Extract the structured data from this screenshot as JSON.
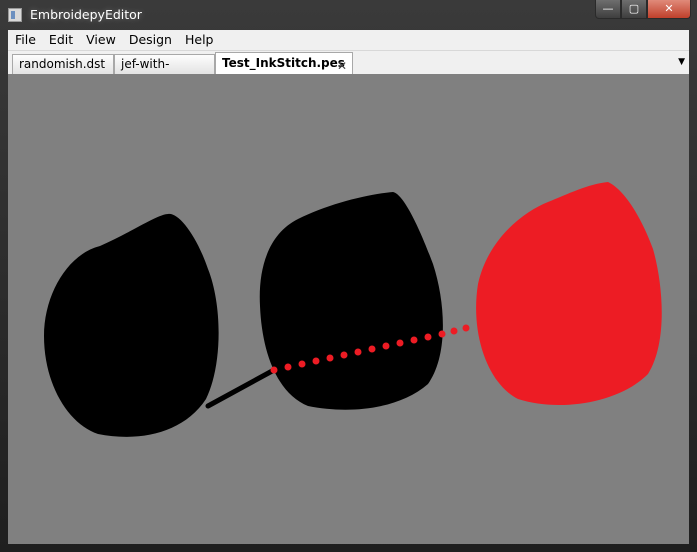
{
  "window": {
    "title": "EmbroidepyEditor",
    "controls": {
      "minimize": "—",
      "maximize": "▢",
      "close": "✕"
    }
  },
  "menu": [
    "File",
    "Edit",
    "View",
    "Design",
    "Help"
  ],
  "tabs": [
    {
      "label": "randomish.dst",
      "active": false
    },
    {
      "label": "jef-with-stop.jef",
      "active": false
    },
    {
      "label": "Test_InkStitch.pes",
      "active": true,
      "close": "✕"
    }
  ],
  "tab_menu_glyph": "▼",
  "icons": {
    "app": "app-window-icon",
    "tab_close": "close-icon",
    "tab_menu": "chevron-down-icon"
  },
  "canvas": {
    "background": "#808080",
    "stitch_colors": {
      "black": "#000000",
      "red": "#ed1c24"
    }
  }
}
